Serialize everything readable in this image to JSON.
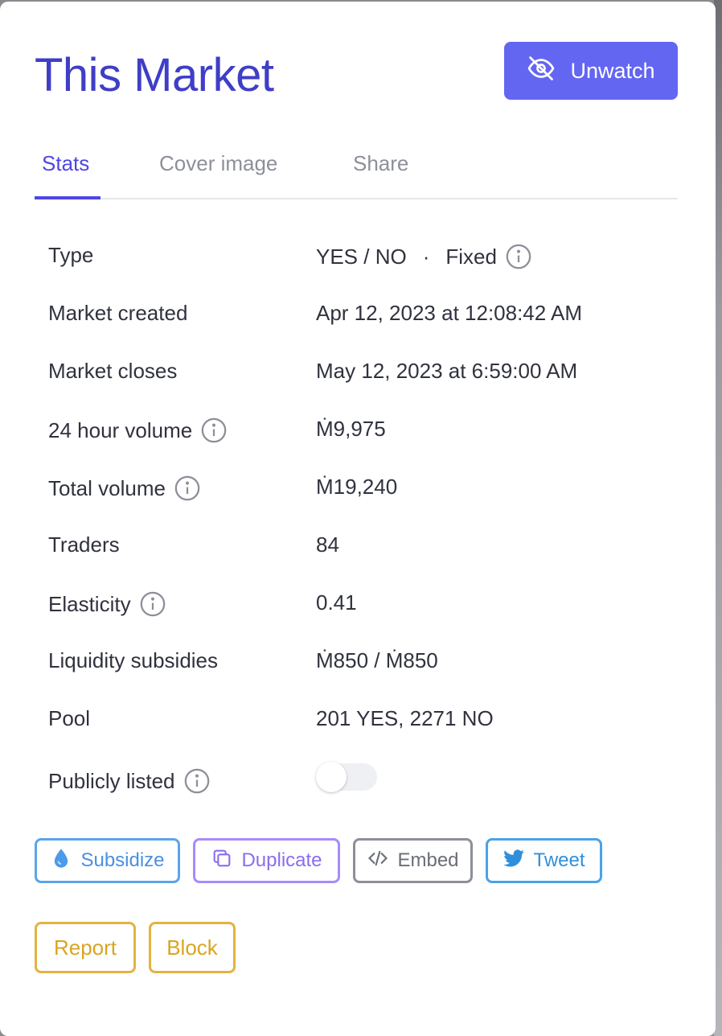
{
  "modal": {
    "title": "This Market",
    "unwatch_label": "Unwatch"
  },
  "tabs": [
    {
      "label": "Stats",
      "active": true
    },
    {
      "label": "Cover image",
      "active": false
    },
    {
      "label": "Share",
      "active": false
    }
  ],
  "stats": {
    "type": {
      "label": "Type",
      "value_a": "YES / NO",
      "sep": "·",
      "value_b": "Fixed"
    },
    "created": {
      "label": "Market created",
      "value": "Apr 12, 2023 at 12:08:42 AM"
    },
    "closes": {
      "label": "Market closes",
      "value": "May 12, 2023 at 6:59:00 AM"
    },
    "volume24": {
      "label": "24 hour volume",
      "value": "Ṁ9,975"
    },
    "total_volume": {
      "label": "Total volume",
      "value": "Ṁ19,240"
    },
    "traders": {
      "label": "Traders",
      "value": "84"
    },
    "elasticity": {
      "label": "Elasticity",
      "value": "0.41"
    },
    "liquidity": {
      "label": "Liquidity subsidies",
      "value": "Ṁ850 / Ṁ850"
    },
    "pool": {
      "label": "Pool",
      "value": "201 YES, 2271 NO"
    },
    "publicly_listed": {
      "label": "Publicly listed",
      "enabled": false
    }
  },
  "actions": {
    "subsidize": "Subsidize",
    "duplicate": "Duplicate",
    "embed": "Embed",
    "tweet": "Tweet",
    "report": "Report",
    "block": "Block"
  },
  "colors": {
    "accent": "#6366f1",
    "title": "#3f3ec7",
    "warning": "#e3b341"
  }
}
